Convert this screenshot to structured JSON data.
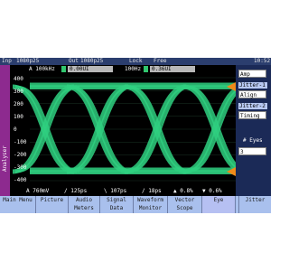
{
  "status": {
    "inp_label": "Inp",
    "inp_value": "1080p25",
    "out_label": "Out",
    "out_value": "1080p25",
    "lock_label": "Lock",
    "lock_value": "Free",
    "time": "10:52"
  },
  "side_tab": {
    "label": "Analyser"
  },
  "measure": {
    "hp1_label": "A 100kHz",
    "hp1_value": "0.00UI",
    "hp2_label": "100Hz",
    "hp2_value": "0.36UI"
  },
  "y_axis": {
    "ticks": [
      "400",
      "300",
      "200",
      "100",
      "0",
      "-100",
      "-200",
      "-300",
      "-400"
    ]
  },
  "footer": {
    "vscale": "A 760mV",
    "hscale": "/ 125ps",
    "pos_x": "\\ 107ps",
    "pos_y": "/ 18ps",
    "marker1": "▲ 0.8%",
    "marker2": "▼ 0.6%"
  },
  "right_panel": {
    "amp_button": "Amp",
    "jitter1_label": "Jitter-1",
    "align_button": "Align",
    "jitter2_label": "Jitter-2",
    "timing_button": "Timing",
    "eyes_label": "# Eyes",
    "eyes_value": "3"
  },
  "menu": [
    {
      "l1": "Main Menu",
      "l2": ""
    },
    {
      "l1": "Picture",
      "l2": ""
    },
    {
      "l1": "Audio",
      "l2": "Meters"
    },
    {
      "l1": "Signal",
      "l2": "Data"
    },
    {
      "l1": "Waveform",
      "l2": "Monitor"
    },
    {
      "l1": "Vector",
      "l2": "Scope"
    },
    {
      "l1": "Eye",
      "l2": ""
    },
    {
      "l1": "",
      "l2": ""
    },
    {
      "l1": "Jitter",
      "l2": ""
    }
  ],
  "colors": {
    "trace": "#2fd080",
    "background": "#1b2a57",
    "side_tab": "#8d2a8f",
    "menu": "#a9c0ed",
    "marker": "#f08a1a"
  }
}
